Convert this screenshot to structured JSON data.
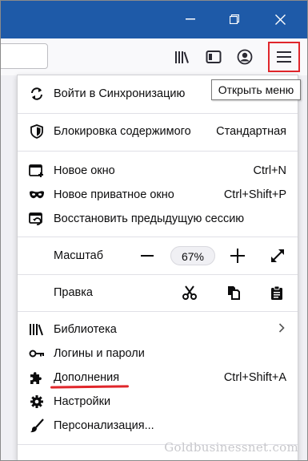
{
  "tooltip": "Открыть меню",
  "menu": {
    "sync_label": "Войти в Синхронизацию",
    "blocking_label": "Блокировка содержимого",
    "blocking_value": "Стандартная",
    "new_window": {
      "label": "Новое окно",
      "shortcut": "Ctrl+N"
    },
    "new_private": {
      "label": "Новое приватное окно",
      "shortcut": "Ctrl+Shift+P"
    },
    "restore": {
      "label": "Восстановить предыдущую сессию"
    },
    "zoom": {
      "label": "Масштаб",
      "value": "67%"
    },
    "edit_label": "Правка",
    "library_label": "Библиотека",
    "logins_label": "Логины и пароли",
    "addons": {
      "label": "Дополнения",
      "shortcut": "Ctrl+Shift+A"
    },
    "settings_label": "Настройки",
    "customize_label": "Персонализация..."
  },
  "watermark": "Goldbusinessnet.com",
  "colors": {
    "titlebar": "#1e5aa8",
    "highlight": "#e0262b"
  },
  "icons": [
    "minimize-icon",
    "restore-icon",
    "close-icon",
    "library-icon",
    "sidebar-icon",
    "account-icon",
    "hamburger-icon",
    "sync-icon",
    "shield-icon",
    "new-window-icon",
    "mask-icon",
    "restore-session-icon",
    "zoom-out-icon",
    "zoom-in-icon",
    "fullscreen-icon",
    "cut-icon",
    "copy-icon",
    "paste-icon",
    "books-icon",
    "chevron-right-icon",
    "key-icon",
    "puzzle-icon",
    "gear-icon",
    "brush-icon"
  ]
}
